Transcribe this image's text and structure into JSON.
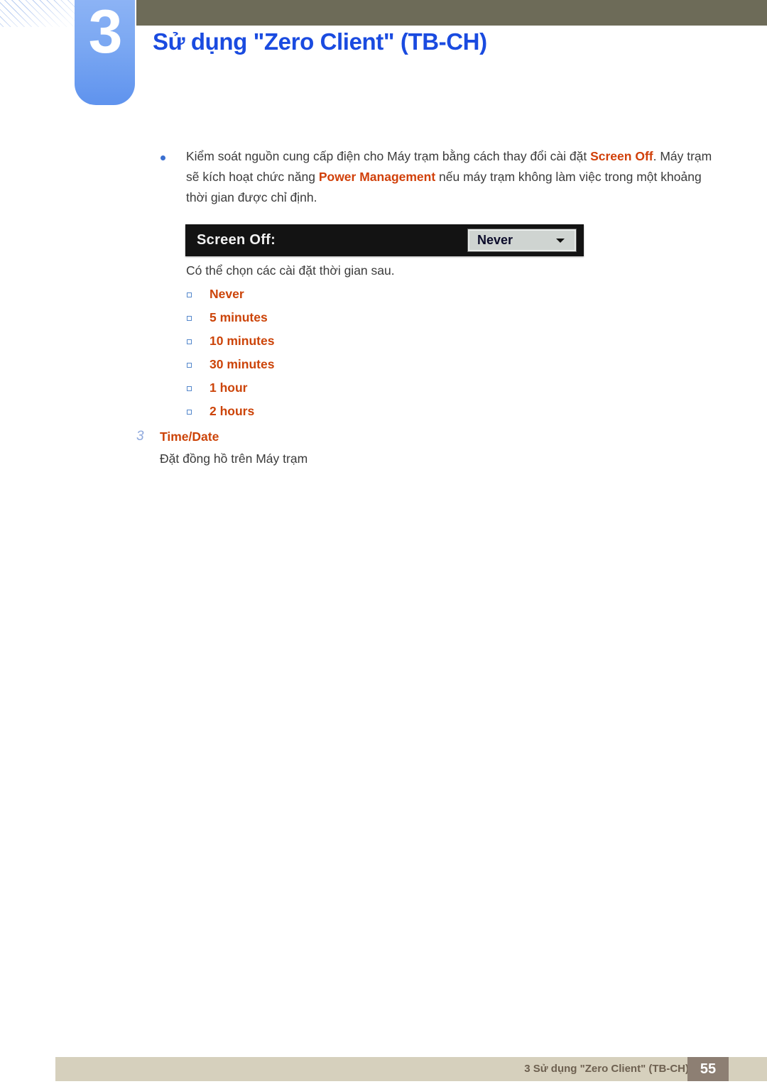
{
  "header": {
    "chapter_number": "3",
    "title": "Sử dụng \"Zero Client\" (TB-CH)",
    "band_color": "#6d6b58",
    "tab_color": "#7aa7f2",
    "title_color": "#1a4be0"
  },
  "body": {
    "bullet": {
      "text_part1": "Kiểm soát nguồn cung cấp điện cho Máy trạm bằng cách thay đổi cài đặt ",
      "bold1": "Screen Off",
      "text_part2": ". Máy trạm sẽ kích hoạt chức năng ",
      "bold2": "Power Management",
      "text_part3": " nếu máy trạm không làm việc trong một khoảng thời gian được chỉ định."
    },
    "widget": {
      "label": "Screen Off:",
      "selected_value": "Never",
      "arrow_icon": "chevron-down-icon",
      "background_color": "#131313"
    },
    "sub_text": "Có thể chọn các cài đặt thời gian sau.",
    "options": [
      {
        "label": "Never"
      },
      {
        "label": "5 minutes"
      },
      {
        "label": "10 minutes"
      },
      {
        "label": "30 minutes"
      },
      {
        "label": "1 hour"
      },
      {
        "label": "2 hours"
      }
    ],
    "option_color": "#cc4409",
    "step": {
      "number": "3",
      "title": "Time/Date",
      "description": "Đặt đồng hồ trên Máy trạm"
    }
  },
  "footer": {
    "text": "3 Sử dụng \"Zero Client\" (TB-CH)",
    "page_number": "55",
    "band_color": "#d6d0bd",
    "page_box_color": "#8d7f73"
  }
}
